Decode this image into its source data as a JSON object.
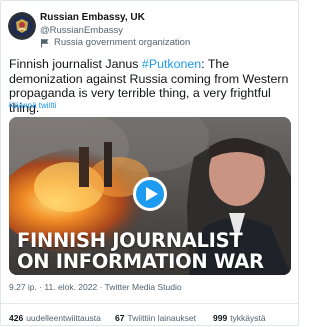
{
  "account": {
    "name": "Russian Embassy, UK",
    "handle": "@RussianEmbassy",
    "affiliation": "Russia government organization"
  },
  "tweet": {
    "text_before": "Finnish journalist Janus ",
    "hashtag": "#Putkonen",
    "text_after": ": The demonization against Russia coming from Western propaganda is very terrible thing, a very frightful thing.",
    "translate_label": "Käännä twiitti"
  },
  "video": {
    "headline_line1": "FINNISH JOURNALIST",
    "headline_line2": "ON INFORMATION WAR"
  },
  "meta": {
    "timestamp": "9.27 ip. · 11. elok. 2022 · Twitter Media Studio"
  },
  "stats": {
    "retweets_count": "426",
    "retweets_label": "uudelleentwiittausta",
    "quotes_count": "67",
    "quotes_label": "Twiittiin lainaukset",
    "likes_count": "999",
    "likes_label": "tykkäystä"
  },
  "colors": {
    "link": "#1d9bf0",
    "text": "#0f1419",
    "secondary": "#536471",
    "play_button": "#1d9bf0"
  }
}
